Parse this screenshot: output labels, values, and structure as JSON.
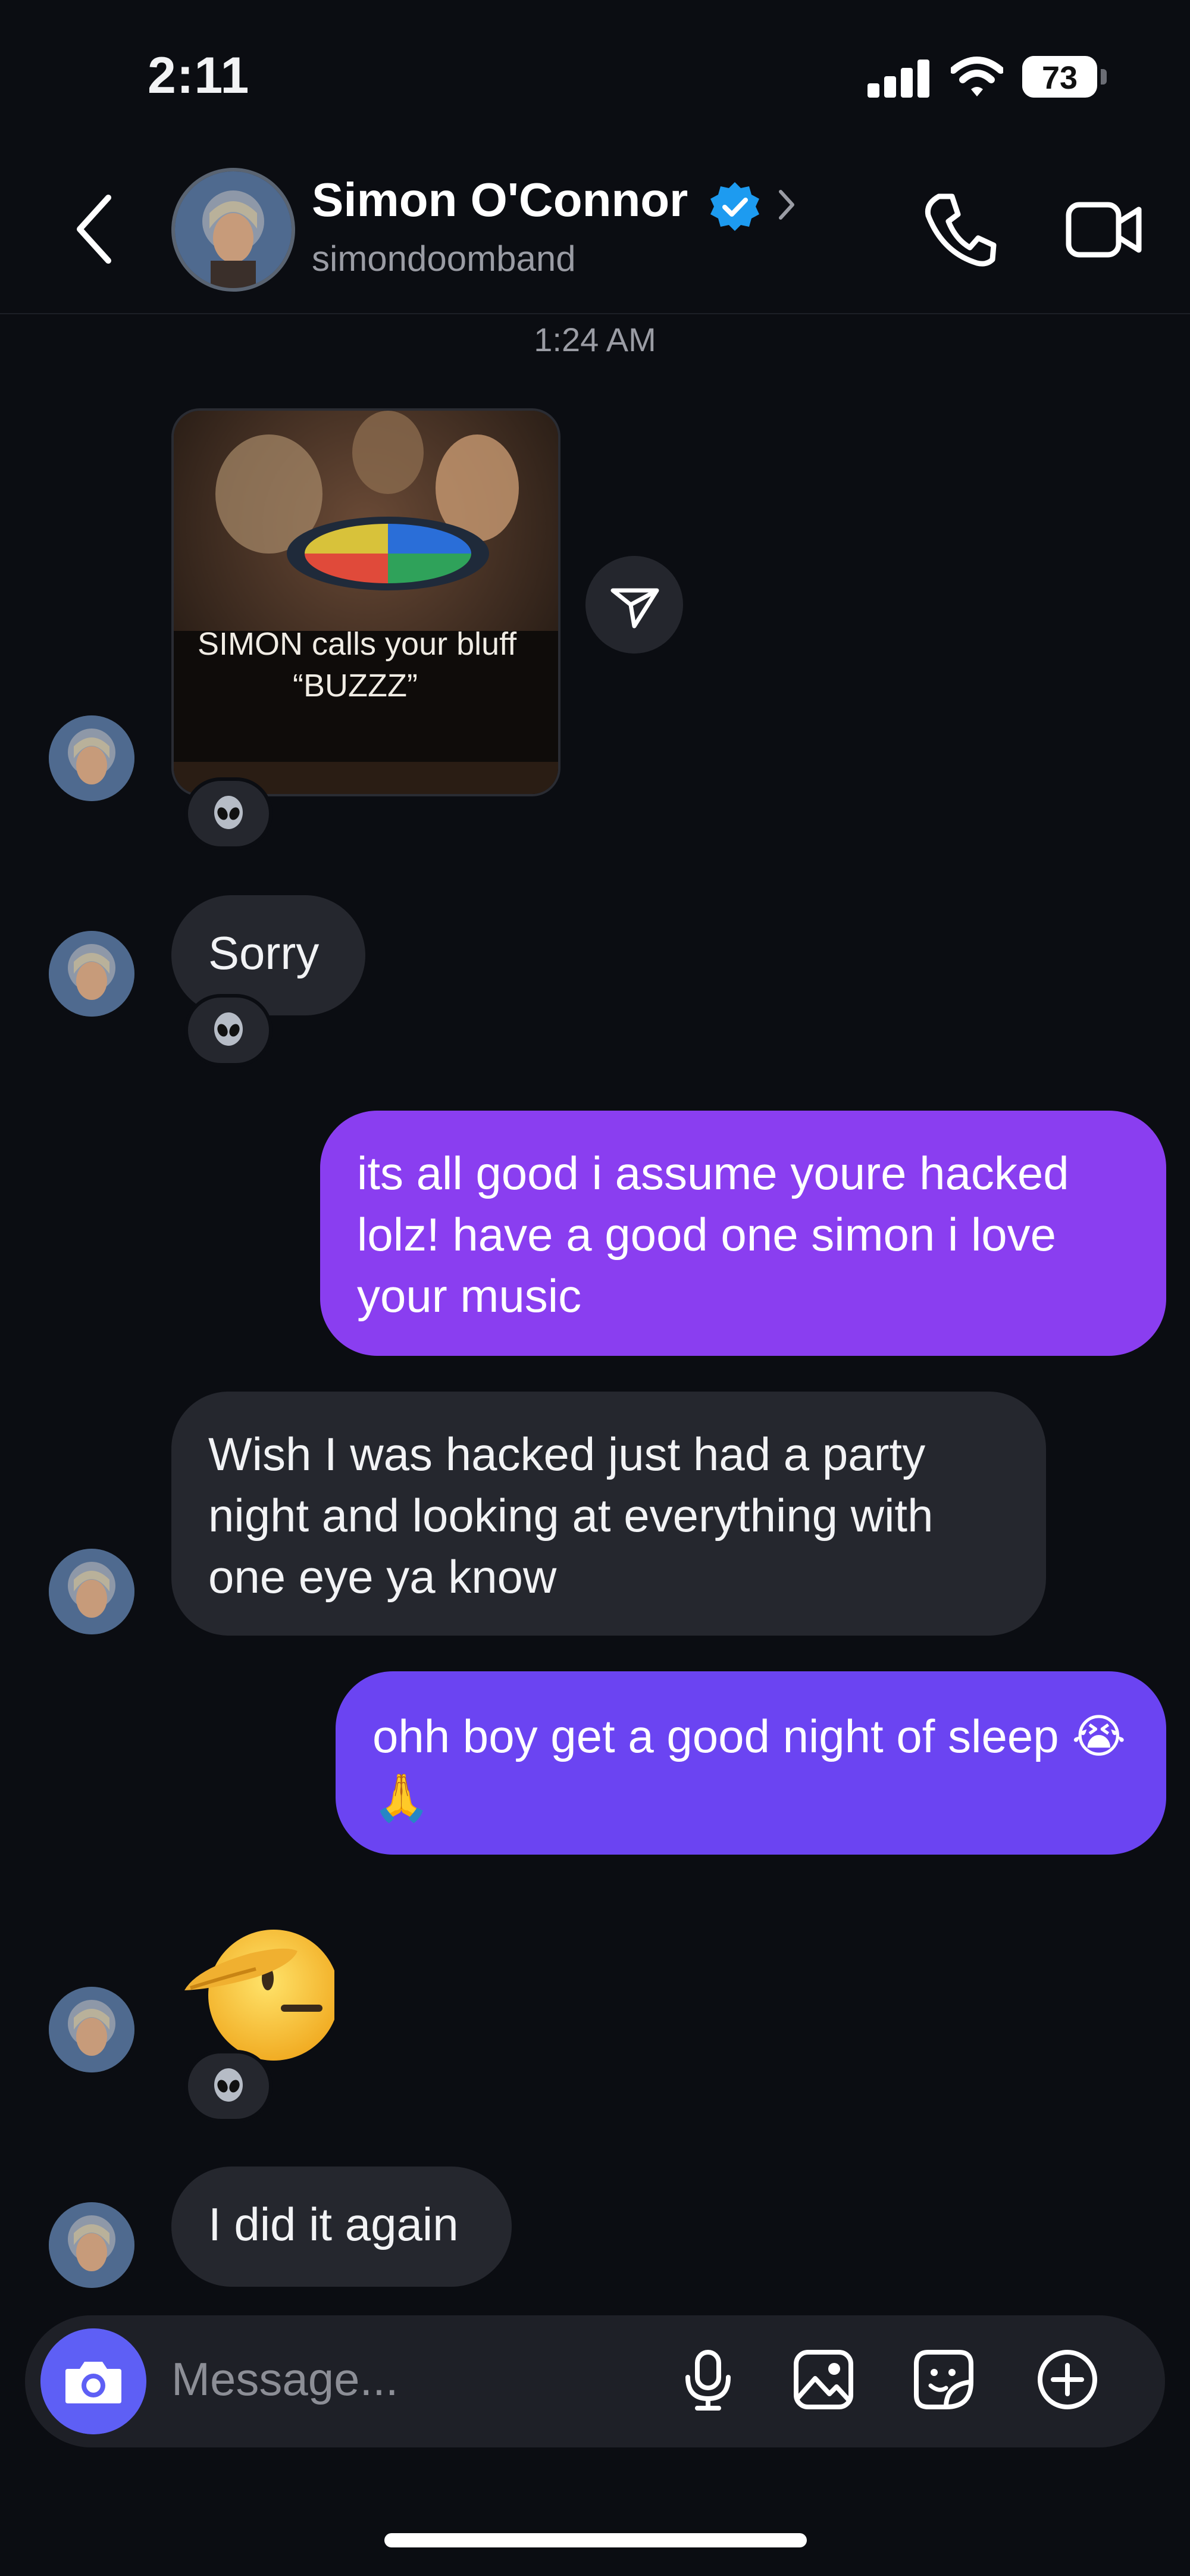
{
  "status_bar": {
    "time": "2:11",
    "battery": "73"
  },
  "header": {
    "name": "Simon O'Connor",
    "username": "simondoomband",
    "icons": [
      "back-icon",
      "verified-icon",
      "chevron-right-icon",
      "phone-icon",
      "video-icon"
    ]
  },
  "timestamp": "1:24 AM",
  "messages": [
    {
      "from": "them",
      "type": "image",
      "image_text": "SIMON calls your bluff “BUZZZ”",
      "caption_line1": "SIMON calls your bluff",
      "caption_line2": "“BUZZZ”",
      "reaction": "alien"
    },
    {
      "from": "them",
      "type": "text",
      "text": "Sorry",
      "reaction": "alien"
    },
    {
      "from": "me",
      "type": "text",
      "text": "its all good i assume youre hacked lolz! have a good one simon i love your music"
    },
    {
      "from": "them",
      "type": "text",
      "text": "Wish I was hacked just had a party night and looking at everything with one eye ya know"
    },
    {
      "from": "me",
      "type": "text",
      "text": "ohh boy get a good night of sleep 😭🙏"
    },
    {
      "from": "them",
      "type": "emoji",
      "text": "saluting-face",
      "reaction": "alien"
    },
    {
      "from": "them",
      "type": "text",
      "text": "I did it again"
    }
  ],
  "composer": {
    "placeholder": "Message...",
    "icons": [
      "camera-icon",
      "microphone-icon",
      "gallery-icon",
      "sticker-icon",
      "plus-icon"
    ]
  },
  "colors": {
    "background": "#0b0d12",
    "incoming_bubble": "#25272e",
    "outgoing_bubble_1": "#8a3ef0",
    "outgoing_bubble_2": "#6b44f2",
    "camera_button": "#5e5ff5",
    "verified": "#1d9bf0"
  }
}
